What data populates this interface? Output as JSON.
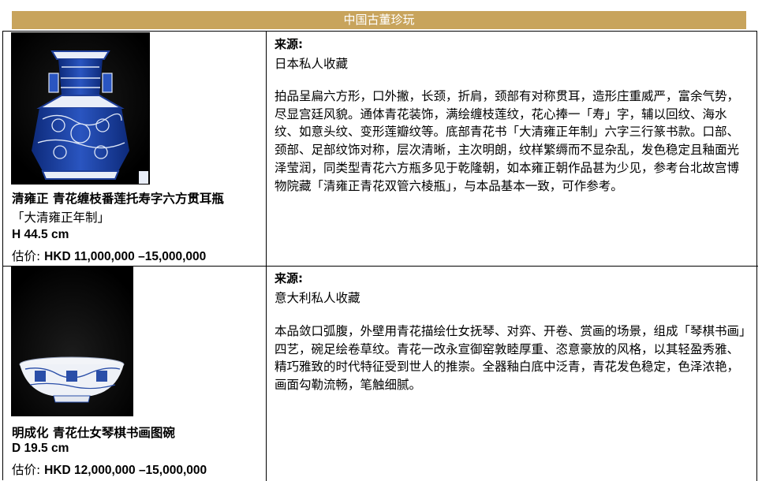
{
  "banner": {
    "title": "中国古董珍玩"
  },
  "lots": [
    {
      "title": "清雍正 青花缠枝番莲托寿字六方贯耳瓶",
      "mark": "「大清雍正年制」",
      "dimension": "H 44.5 cm",
      "estimate_label": "估价:",
      "estimate_value": "HKD 11,000,000 –15,000,000",
      "provenance_label": "来源:",
      "provenance": "日本私人收藏",
      "description": "拍品呈扁六方形，口外撇，长颈，折肩，颈部有对称贯耳，造形庄重威严，富余气势，尽显宫廷风貌。通体青花装饰，满绘缠枝莲纹，花心捧一「寿」字，辅以回纹、海水纹、如意头纹、变形莲瓣纹等。底部青花书「大清雍正年制」六字三行篆书款。口部、颈部、足部纹饰对称，层次清晰，主次明朗，纹样繁缛而不显杂乱，发色稳定且釉面光泽莹润，同类型青花六方瓶多见于乾隆朝，如本雍正朝作品甚为少见，参考台北故宫博物院藏「清雍正青花双管六棱瓶」，与本品基本一致，可作参考。"
    },
    {
      "title": "明成化 青花仕女琴棋书画图碗",
      "dimension": "D 19.5 cm",
      "estimate_label": "估价:",
      "estimate_value": "HKD 12,000,000 –15,000,000",
      "provenance_label": "来源:",
      "provenance": "意大利私人收藏",
      "description": "本品敛口弧腹，外壁用青花描绘仕女抚琴、对弈、开卷、赏画的场景，组成「琴棋书画」四艺，碗足绘卷草纹。青花一改永宣御窑敦睦厚重、恣意豪放的风格，以其轻盈秀雅、精巧雅致的时代特征受到世人的推崇。全器釉白底中泛青，青花发色稳定，色泽浓艳，画面勾勒流畅，笔触细腻。"
    }
  ],
  "colors": {
    "banner": "#c8a45c",
    "porcelain_blue": "#1f3f9a",
    "photo_bg": "#050505"
  }
}
